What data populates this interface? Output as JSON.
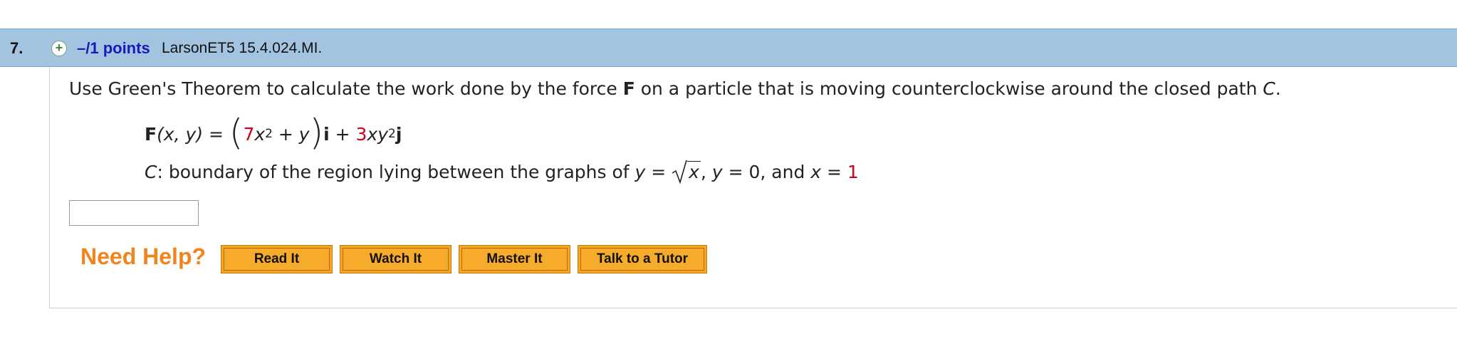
{
  "question": {
    "number": "7.",
    "points": "–/1 points",
    "source": "LarsonET5 15.4.024.MI.",
    "prompt": {
      "before_F": "Use Green's Theorem to calculate the work done by the force ",
      "F": "F",
      "after_F": " on a particle that is moving counterclockwise around the closed path ",
      "C": "C",
      "end": "."
    },
    "formula": {
      "lhs_F": "F",
      "lhs_args": "(x, y)",
      "equals": " = ",
      "coef1": "7",
      "x_var": "x",
      "exp1": "2",
      "plus_y": " + y",
      "i_vec": "i",
      "plus": " + ",
      "coef2": "3",
      "xy": "xy",
      "exp2": "2",
      "j_vec": "j"
    },
    "path": {
      "C": "C",
      "text": ": boundary of the region lying between the graphs of ",
      "y1": "y",
      "eq1": " = ",
      "rad": "x",
      "mid": ", ",
      "y2": "y",
      "eq2": " = 0, and ",
      "x_var": "x",
      "eq3": " = ",
      "x_val": "1"
    },
    "answer_value": ""
  },
  "help": {
    "label": "Need Help?",
    "buttons": [
      "Read It",
      "Watch It",
      "Master It",
      "Talk to a Tutor"
    ]
  },
  "colors": {
    "header_bg": "#a3c4e0",
    "points_blue": "#1a1ab8",
    "highlight_red": "#d0021b",
    "help_orange": "#f0851d",
    "button_orange": "#f5a623"
  }
}
